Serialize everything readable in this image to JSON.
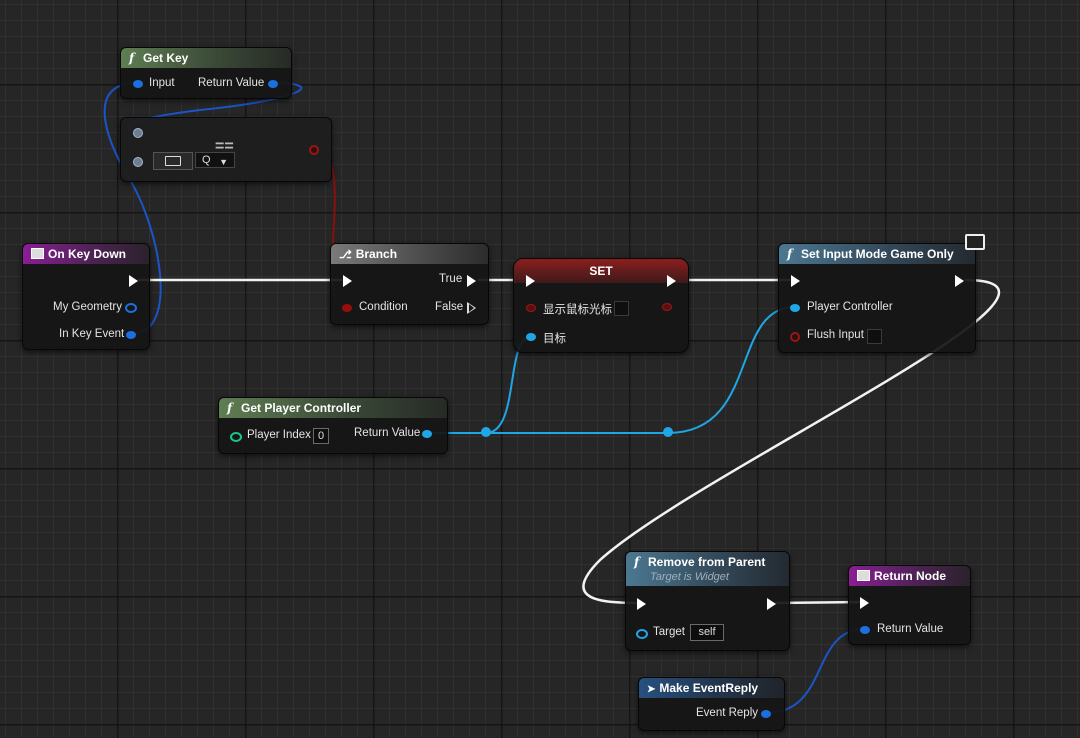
{
  "nodes": {
    "get_key": {
      "title": "Get Key",
      "input": "Input",
      "return_value": "Return Value"
    },
    "equals": {
      "title": "==",
      "key_value": "Q"
    },
    "on_key_down": {
      "title": "On Key Down",
      "my_geometry": "My Geometry",
      "in_key_event": "In Key Event"
    },
    "branch": {
      "title": "Branch",
      "true_label": "True",
      "false_label": "False",
      "condition": "Condition"
    },
    "set": {
      "title": "SET",
      "variable": "显示鼠标光标",
      "target": "目标"
    },
    "set_input_mode": {
      "title": "Set Input Mode Game Only",
      "player_controller": "Player Controller",
      "flush_input": "Flush Input"
    },
    "get_player_controller": {
      "title": "Get Player Controller",
      "player_index": "Player Index",
      "player_index_value": "0",
      "return_value": "Return Value"
    },
    "remove_from_parent": {
      "title": "Remove from Parent",
      "subtitle": "Target is Widget",
      "target": "Target",
      "target_value": "self"
    },
    "return_node": {
      "title": "Return Node",
      "return_value": "Return Value"
    },
    "make_event_reply": {
      "title": "Make EventReply",
      "event_reply": "Event Reply"
    }
  },
  "icons": {
    "function": "f",
    "branch": "branch-icon",
    "keyboard": "keyboard-icon",
    "event": "event-icon",
    "monitor": "monitor-icon"
  },
  "colors": {
    "exec_wire": "#ffffff",
    "struct_wire": "#1b6fe0",
    "object_wire": "#1fa6e6",
    "bool_wire": "#8a0f0f",
    "function_header": "#5f7e52",
    "event_header": "#8a1e94",
    "target_function_header": "#4b7891",
    "set_header": "#8c1e1e"
  }
}
